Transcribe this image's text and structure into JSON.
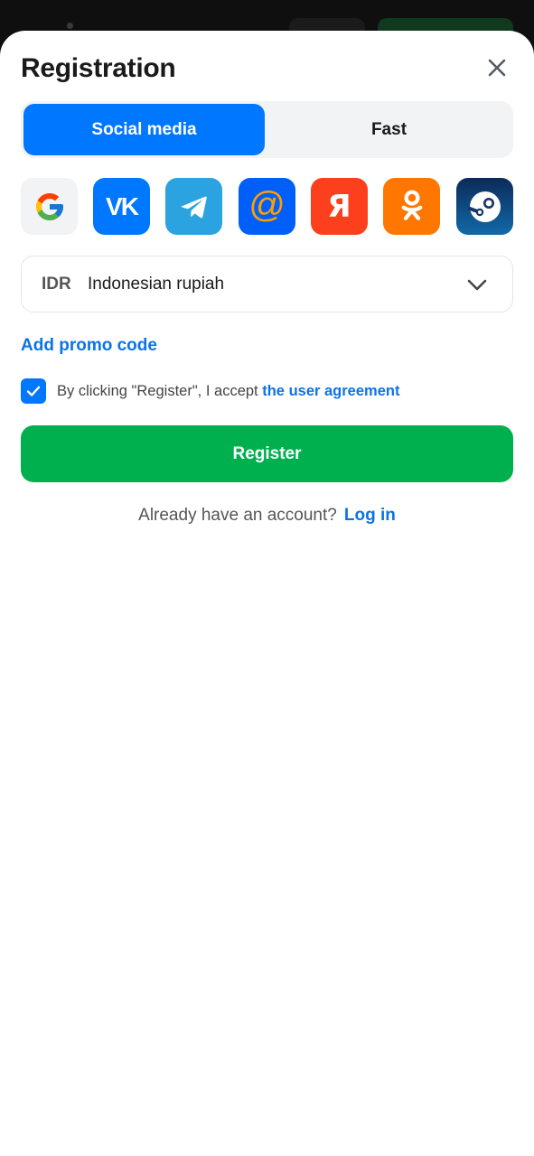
{
  "header": {
    "title": "Registration",
    "close_icon": "close-icon"
  },
  "tabs": [
    {
      "label": "Social media",
      "active": true
    },
    {
      "label": "Fast",
      "active": false
    }
  ],
  "social_providers": [
    {
      "name": "Google",
      "icon": "google-icon",
      "color": "#f2f3f5"
    },
    {
      "name": "VK",
      "icon": "vk-icon",
      "color": "#0077ff"
    },
    {
      "name": "Telegram",
      "icon": "telegram-icon",
      "color": "#2aa3e0"
    },
    {
      "name": "Mail.ru",
      "icon": "mailru-icon",
      "color": "#005ff9"
    },
    {
      "name": "Yandex",
      "icon": "yandex-icon",
      "color": "#fc3f1d"
    },
    {
      "name": "Odnoklassniki",
      "icon": "odnoklassniki-icon",
      "color": "#ff7700"
    },
    {
      "name": "Steam",
      "icon": "steam-icon",
      "color": "#0b2a5a"
    }
  ],
  "currency": {
    "code": "IDR",
    "name": "Indonesian rupiah"
  },
  "promo": {
    "label": "Add promo code"
  },
  "agreement": {
    "checked": true,
    "text": "By clicking \"Register\", I accept",
    "link": "the user agreement"
  },
  "register_button": {
    "label": "Register"
  },
  "login": {
    "prompt": "Already have an account?",
    "link": "Log in"
  },
  "colors": {
    "primary": "#0077ff",
    "link": "#0a74e6",
    "register": "#00b04f"
  }
}
